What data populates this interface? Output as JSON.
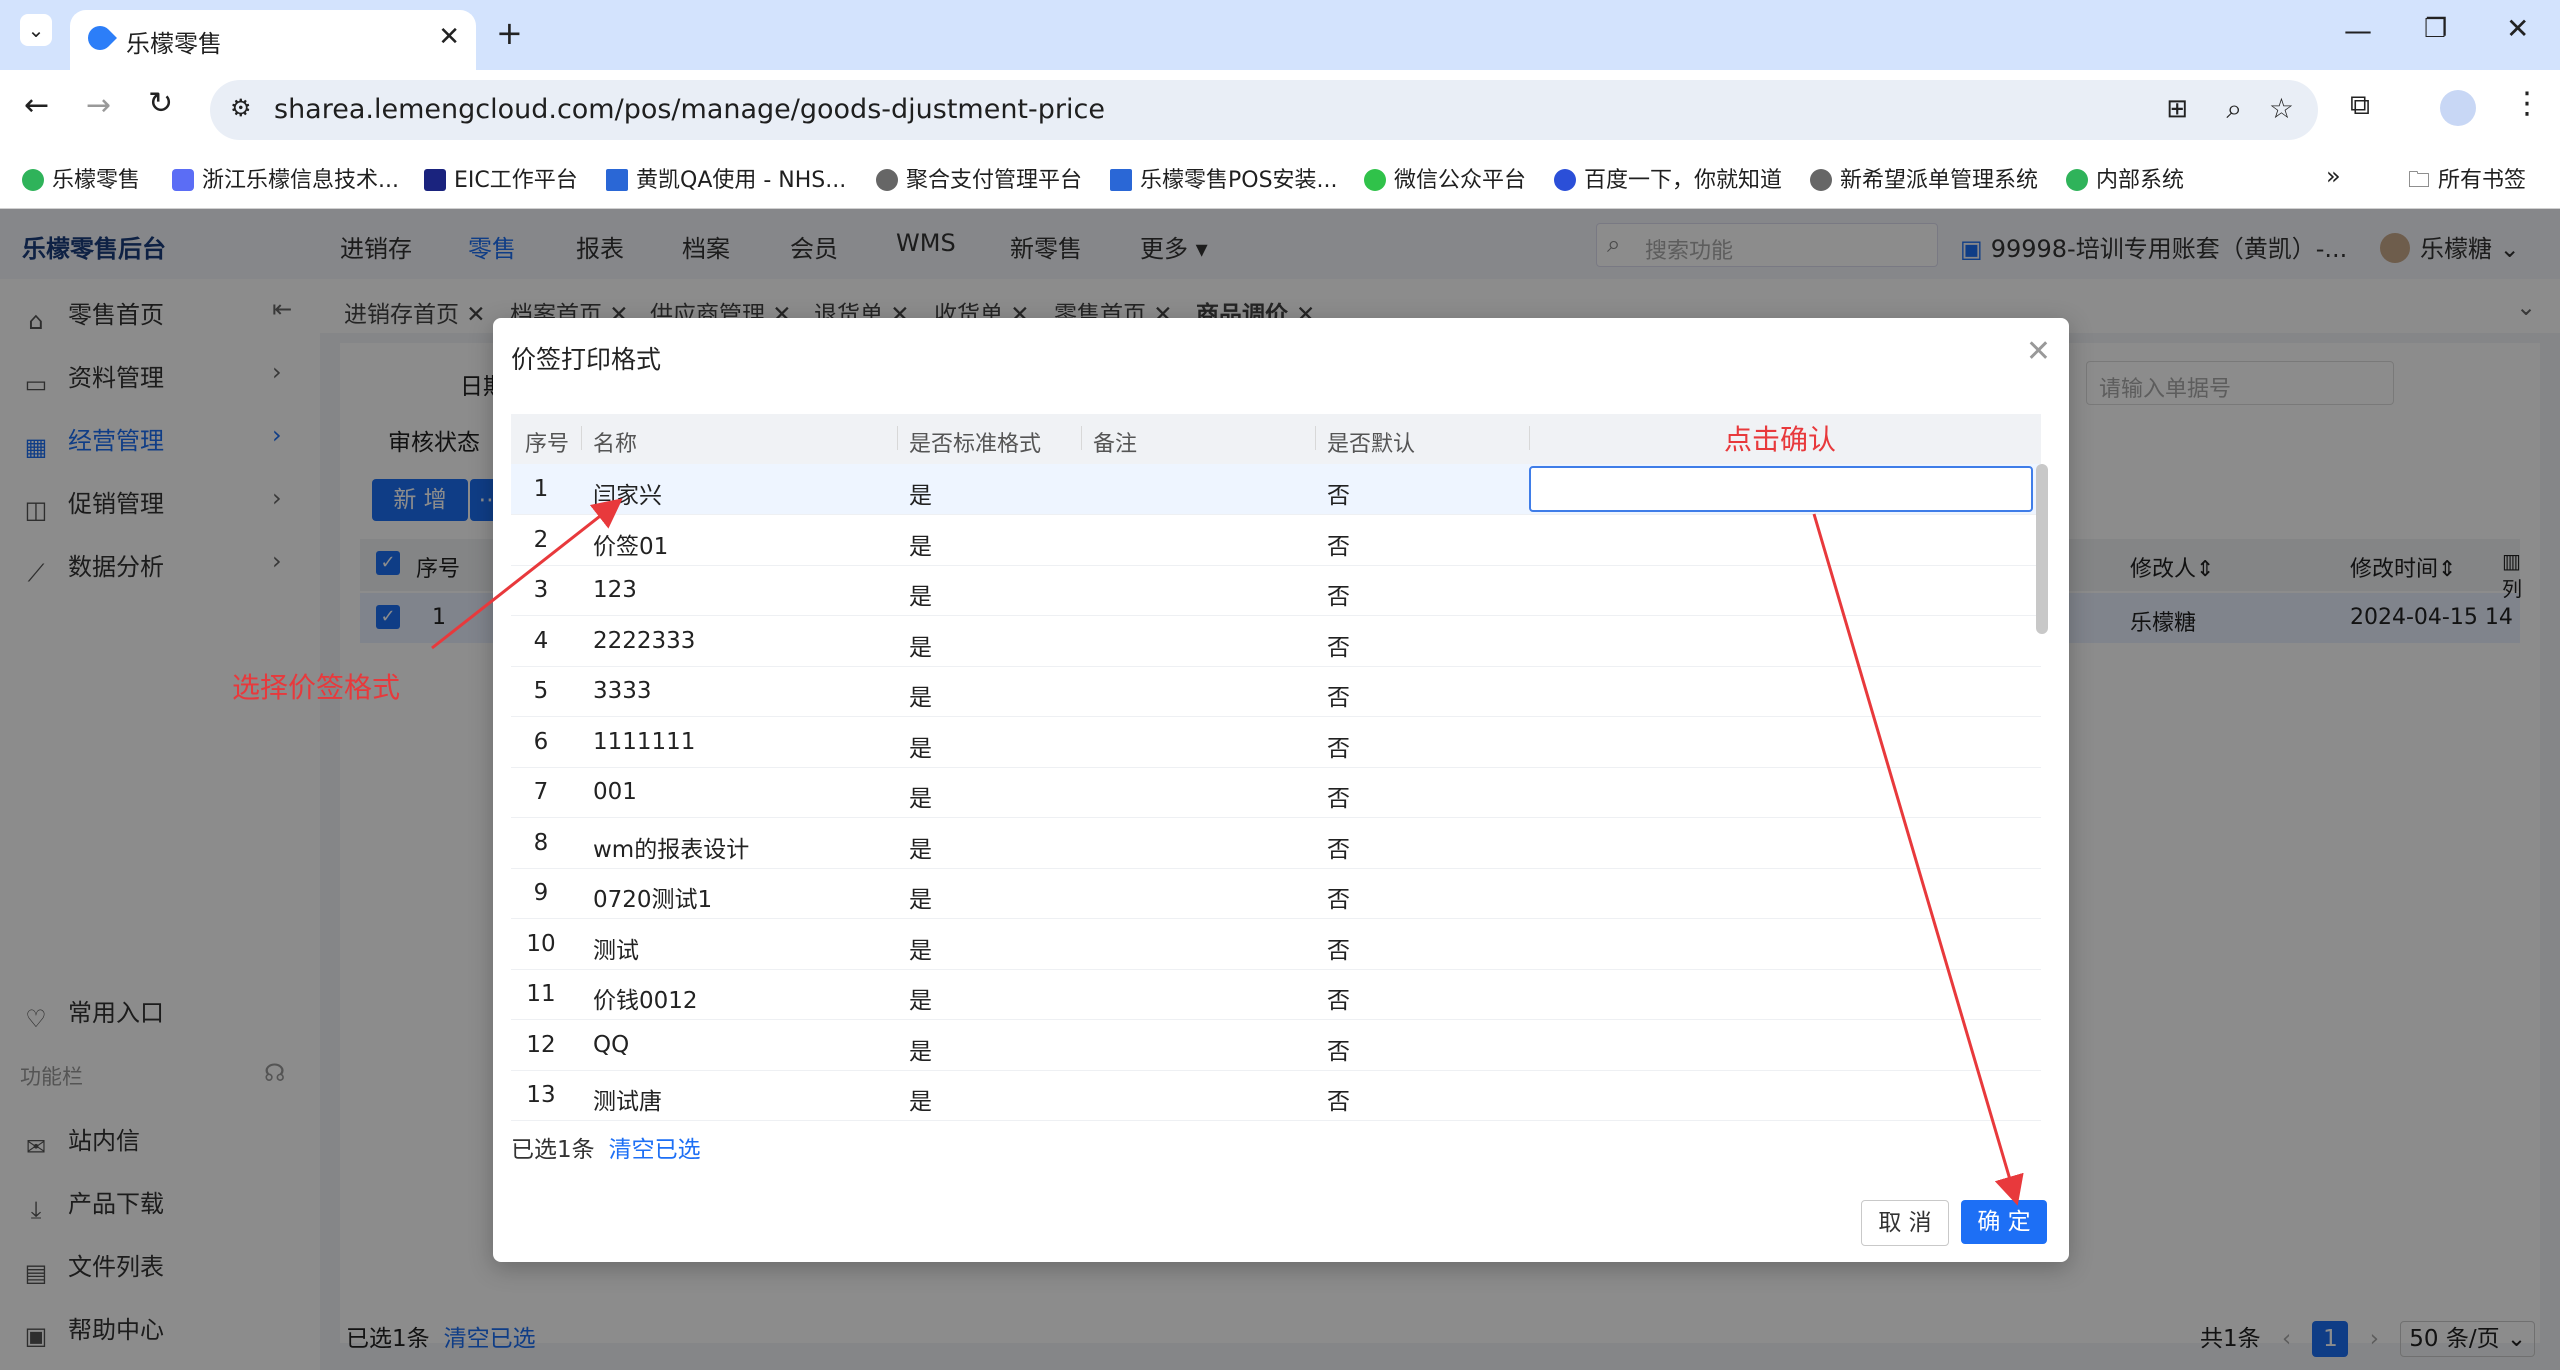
{
  "browser": {
    "tab_title": "乐檬零售",
    "url": "sharea.lemengcloud.com/pos/manage/goods-djustment-price",
    "bookmarks": [
      "乐檬零售",
      "浙江乐檬信息技术...",
      "EIC工作平台",
      "黄凯QA使用 - NHS...",
      "聚合支付管理平台",
      "乐檬零售POS安装...",
      "微信公众平台",
      "百度一下，你就知道",
      "新希望派单管理系统",
      "内部系统"
    ],
    "all_bookmarks": "所有书签"
  },
  "app": {
    "logo": "乐檬零售后台",
    "nav": [
      "进销存",
      "零售",
      "报表",
      "档案",
      "会员",
      "WMS",
      "新零售",
      "更多"
    ],
    "search_placeholder": "搜索功能",
    "account": "99998-培训专用账套（黄凯）-...",
    "user": "乐檬糖",
    "sidebar": [
      "零售首页",
      "资料管理",
      "经营管理",
      "促销管理",
      "数据分析"
    ],
    "sidebar_bottom": [
      "常用入口",
      "功能栏",
      "站内信",
      "产品下载",
      "文件列表",
      "帮助中心"
    ],
    "breadcrumbs": [
      "进销存首页",
      "档案首页",
      "供应商管理",
      "退货单",
      "收货单",
      "零售首页",
      "商品调价"
    ],
    "bg_labels": {
      "date": "日期",
      "status": "审核状态",
      "new": "新 增",
      "seq": "序号",
      "modifier": "修改人",
      "modify_time": "修改时间",
      "col": "列",
      "order_placeholder": "请输入单据号",
      "row_no": "1",
      "row_user": "乐檬糖",
      "row_time": "2024-04-15 14",
      "selected": "已选1条",
      "clear": "清空已选",
      "total": "共1条",
      "page": "1",
      "page_size": "50 条/页"
    }
  },
  "modal": {
    "title": "价签打印格式",
    "columns": [
      "序号",
      "名称",
      "是否标准格式",
      "备注",
      "是否默认"
    ],
    "rows": [
      [
        "1",
        "闫家兴",
        "是",
        "",
        "否"
      ],
      [
        "2",
        "价签01",
        "是",
        "",
        "否"
      ],
      [
        "3",
        "123",
        "是",
        "",
        "否"
      ],
      [
        "4",
        "2222333",
        "是",
        "",
        "否"
      ],
      [
        "5",
        "3333",
        "是",
        "",
        "否"
      ],
      [
        "6",
        "1111111",
        "是",
        "",
        "否"
      ],
      [
        "7",
        "001",
        "是",
        "",
        "否"
      ],
      [
        "8",
        "wm的报表设计",
        "是",
        "",
        "否"
      ],
      [
        "9",
        "0720测试1",
        "是",
        "",
        "否"
      ],
      [
        "10",
        "测试",
        "是",
        "",
        "否"
      ],
      [
        "11",
        "价钱0012",
        "是",
        "",
        "否"
      ],
      [
        "12",
        "QQ",
        "是",
        "",
        "否"
      ],
      [
        "13",
        "测试唐",
        "是",
        "",
        "否"
      ]
    ],
    "selected_text": "已选1条",
    "clear_text": "清空已选",
    "cancel": "取 消",
    "ok": "确 定"
  },
  "annotations": {
    "select_format": "选择价签格式",
    "click_confirm": "点击确认"
  },
  "colors": {
    "accent": "#1d6ff5",
    "annotation": "#e8393c"
  }
}
